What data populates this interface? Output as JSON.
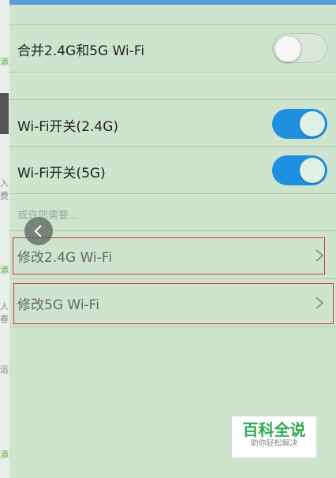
{
  "settings": {
    "merge_label": "合并2.4G和5G Wi-Fi",
    "merge_enabled": false,
    "wifi24_label": "Wi-Fi开关(2.4G)",
    "wifi24_enabled": true,
    "wifi5_label": "Wi-Fi开关(5G)",
    "wifi5_enabled": true
  },
  "suggestions": {
    "hint": "或许您需要...",
    "items": [
      {
        "label": "修改2.4G Wi-Fi"
      },
      {
        "label": "修改5G Wi-Fi"
      }
    ]
  },
  "background": {
    "tags": [
      "添",
      "入费",
      "添",
      "人春",
      "运",
      "添"
    ]
  },
  "watermark": {
    "title": "百科全说",
    "subtitle": "助你轻松解决"
  },
  "colors": {
    "accent": "#1f8fe0",
    "top_bar": "#5b9bd8",
    "highlight": "#d03a3a",
    "panel_bg": "#cfe4cf"
  },
  "icons": {
    "back": "chevron-left-icon",
    "row_arrow": "chevron-right-icon"
  }
}
